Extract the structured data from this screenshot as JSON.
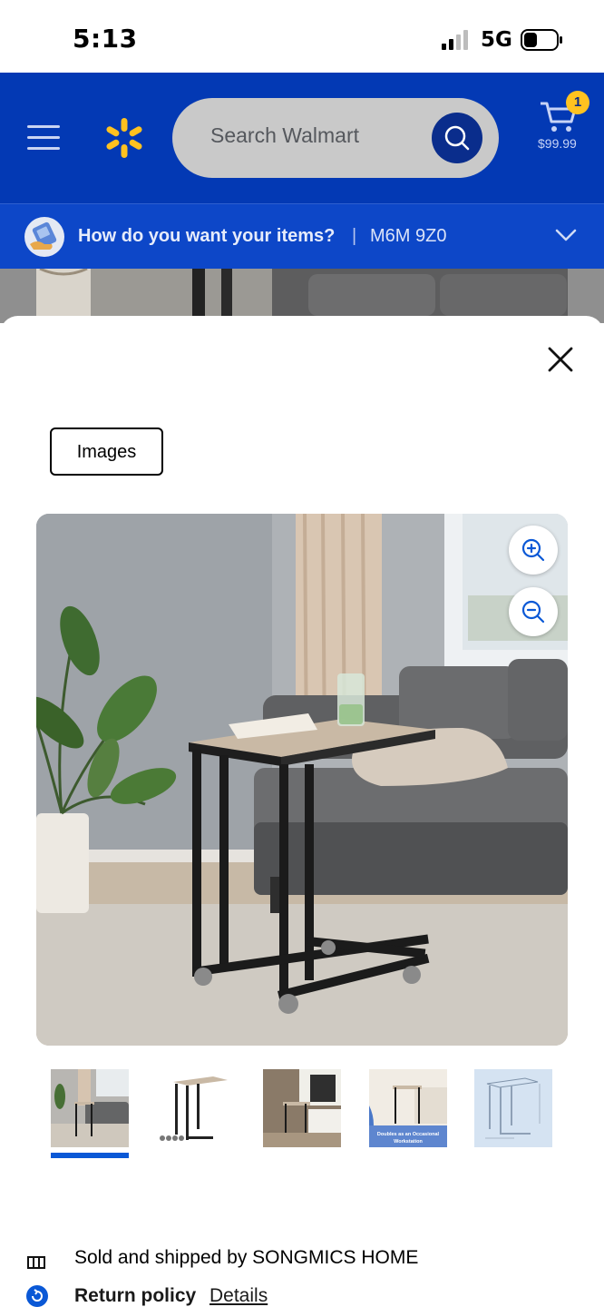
{
  "status_bar": {
    "time": "5:13",
    "network": "5G"
  },
  "header": {
    "search_placeholder": "Search Walmart",
    "cart_count": "1",
    "cart_total": "$99.99"
  },
  "fulfillment": {
    "prompt": "How do you want your items?",
    "separator": "|",
    "postal_code": "M6M 9Z0"
  },
  "modal": {
    "tab_label": "Images",
    "thumbnails": [
      {
        "id": "living-room-side-table"
      },
      {
        "id": "table-with-casters"
      },
      {
        "id": "bedroom-table"
      },
      {
        "id": "workstation-table",
        "caption": "Doubles as an Occasional Workstation"
      },
      {
        "id": "dimension-drawing"
      }
    ],
    "selected_thumbnail": 0
  },
  "footer": {
    "sold_by": "Sold and shipped by SONGMICS HOME",
    "return_policy_label": "Return policy",
    "return_policy_link": "Details"
  },
  "colors": {
    "header_blue": "#0339b4",
    "strip_blue": "#0d47c8",
    "spark_yellow": "#ffc220",
    "accent_blue": "#0a58d6"
  }
}
